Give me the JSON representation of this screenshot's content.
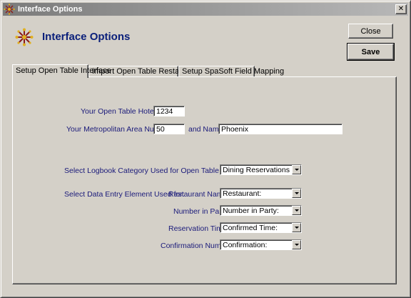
{
  "window": {
    "title": "Interface Options",
    "close_glyph": "✕"
  },
  "header": {
    "title": "Interface Options",
    "icon": "compass-star-icon"
  },
  "buttons": {
    "close_label": "Close",
    "save_label": "Save"
  },
  "tabs": [
    {
      "label": "Setup Open Table Interface",
      "active": true
    },
    {
      "label": "Import Open Table Restaurant List",
      "active": false
    },
    {
      "label": "Setup SpaSoft Field Mapping",
      "active": false
    }
  ],
  "form": {
    "hotel_id": {
      "label": "Your Open Table Hotel ID:",
      "value": "1234"
    },
    "metro_area": {
      "label": "Your  Metropolitan Area Number:",
      "value": "50"
    },
    "metro_name": {
      "label": "and Name:",
      "value": "Phoenix"
    },
    "logbook_category": {
      "label": "Select Logbook Category Used for Open Table Reservations:",
      "value": "Dining Reservations"
    },
    "data_entry_intro": "Select Data Entry Element Used for:",
    "restaurant_name": {
      "label": "Restaurant Name:",
      "value": "Restaurant:"
    },
    "number_in_party": {
      "label": "Number in Party:",
      "value": "Number in Party:"
    },
    "reservation_time": {
      "label": "Reservation Time:",
      "value": "Confirmed Time:"
    },
    "confirmation_number": {
      "label": "Confirmation Number:",
      "value": "Confirmation:"
    }
  },
  "colors": {
    "title_text": "#0a1f7a",
    "dialog_face": "#d4d0c8"
  }
}
